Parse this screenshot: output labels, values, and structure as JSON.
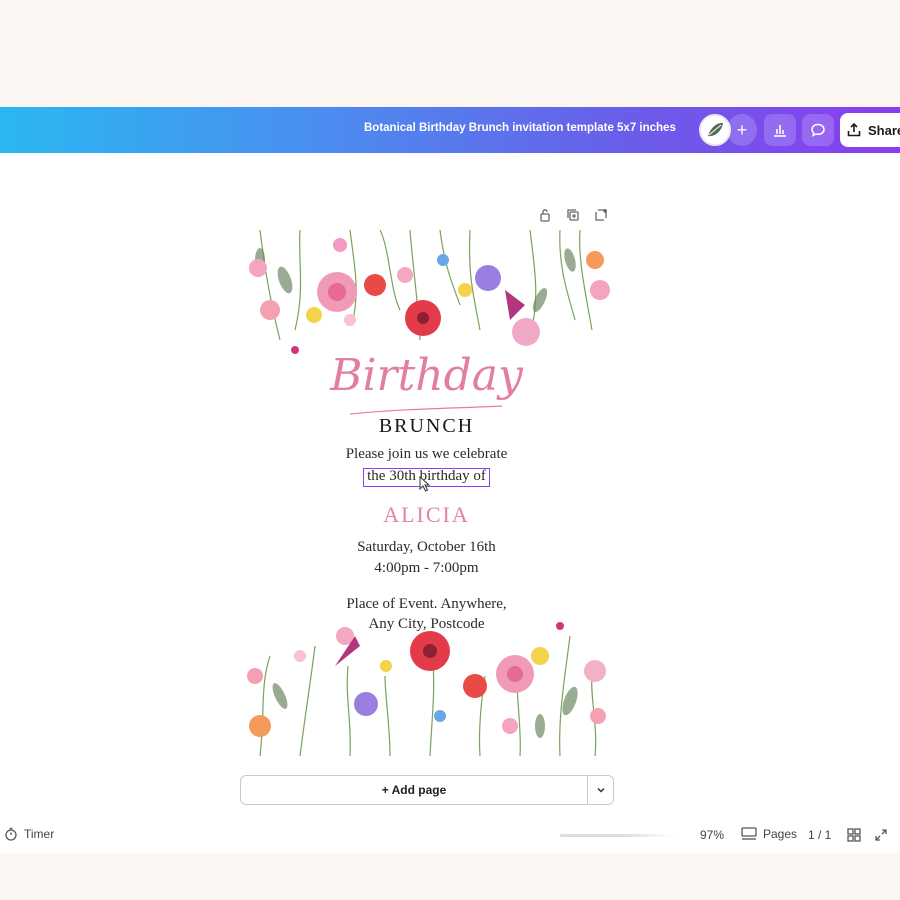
{
  "header": {
    "doc_title": "Botanical Birthday Brunch invitation template 5x7 inches",
    "add_collab": "+",
    "share_label": "Share"
  },
  "invite": {
    "title_script": "Birthday",
    "subtitle": "BRUNCH",
    "line1": "Please join us we celebrate",
    "line2": "the 30th birthday of",
    "name": "ALICIA",
    "date": "Saturday, October 16th",
    "time": "4:00pm - 7:00pm",
    "place1": "Place of Event. Anywhere,",
    "place2": "Any City, Postcode"
  },
  "canvas": {
    "add_page_label": "+ Add page"
  },
  "footer": {
    "timer_label": "Timer",
    "zoom": "97%",
    "pages_label": "Pages",
    "page_count": "1 / 1"
  },
  "colors": {
    "accent": "#8b3dff",
    "pink": "#df84a3",
    "gradient_start": "#2ab7f1",
    "gradient_end": "#8a3df0"
  }
}
